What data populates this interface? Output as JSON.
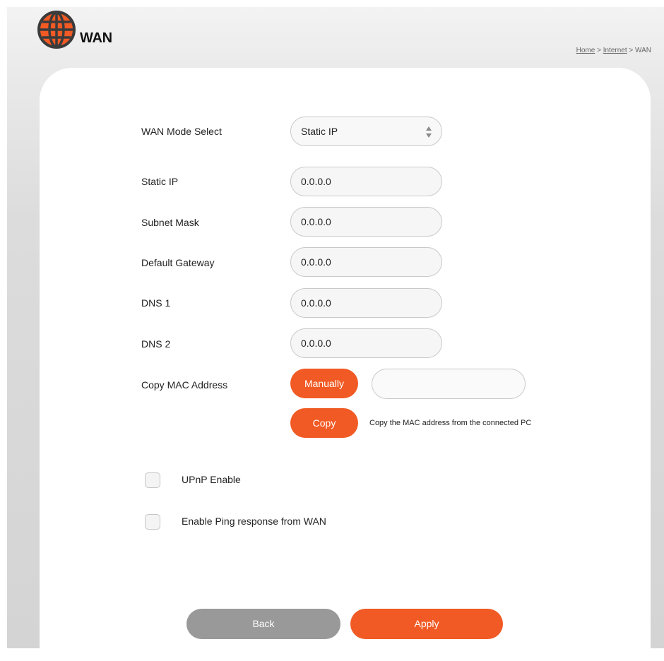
{
  "header": {
    "title": "WAN",
    "icon": "globe-icon",
    "breadcrumb": {
      "home": "Home",
      "separator1": " > ",
      "internet": "Internet",
      "separator2": " > ",
      "current": "WAN"
    }
  },
  "form": {
    "wan_mode": {
      "label": "WAN Mode Select",
      "value": "Static IP"
    },
    "static_ip": {
      "label": "Static IP",
      "value": "0.0.0.0"
    },
    "subnet_mask": {
      "label": "Subnet Mask",
      "value": "0.0.0.0"
    },
    "default_gateway": {
      "label": "Default Gateway",
      "value": "0.0.0.0"
    },
    "dns1": {
      "label": "DNS 1",
      "value": "0.0.0.0"
    },
    "dns2": {
      "label": "DNS 2",
      "value": "0.0.0.0"
    },
    "mac": {
      "label": "Copy MAC Address",
      "manual_button": "Manually",
      "input_value": "",
      "copy_button": "Copy",
      "copy_note": "Copy the MAC address from the connected PC"
    },
    "upnp": {
      "label": "UPnP Enable",
      "checked": false
    },
    "ping": {
      "label": "Enable Ping response from WAN",
      "checked": false
    }
  },
  "actions": {
    "back": "Back",
    "apply": "Apply"
  },
  "colors": {
    "accent": "#f15a24",
    "secondary_button": "#999999",
    "icon_dark": "#3b3b3b"
  }
}
